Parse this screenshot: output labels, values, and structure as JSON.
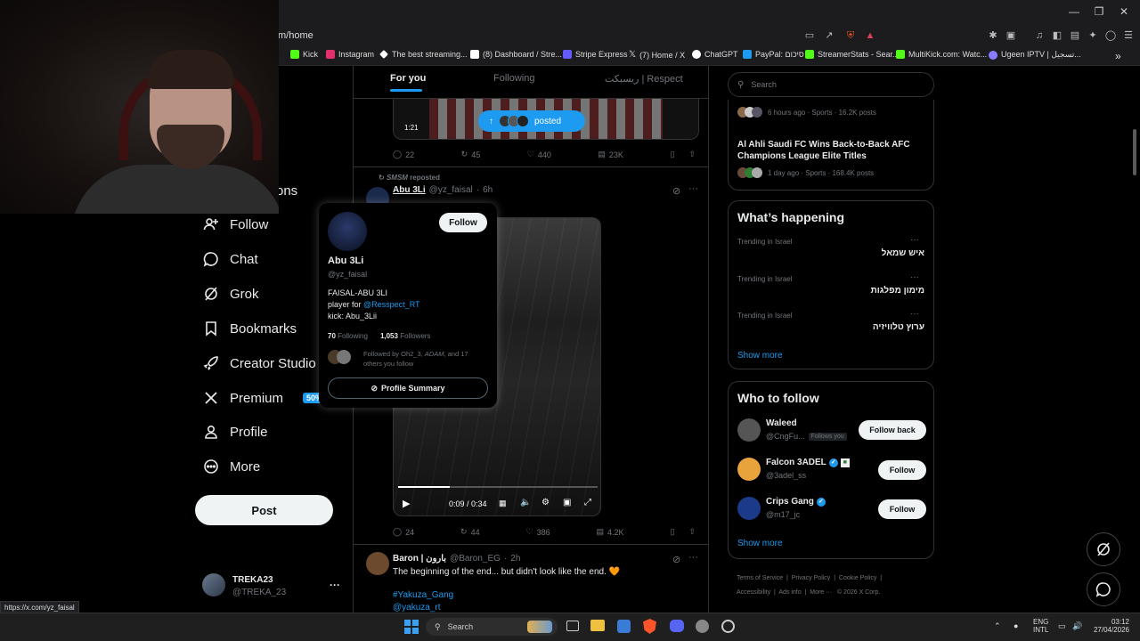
{
  "browser": {
    "url": "m/home",
    "status_url": "https://x.com/yz_faisal",
    "bookmarks": [
      {
        "label": "Kick",
        "color": "#53fc18"
      },
      {
        "label": "Instagram",
        "color": "#e1306c"
      },
      {
        "label": "The best streaming...",
        "color": "#ffffff"
      },
      {
        "label": "(8) Dashboard / Stre...",
        "color": "#ffffff"
      },
      {
        "label": "Stripe Express",
        "color": "#635bff"
      },
      {
        "label": "(7) Home / X",
        "color": "#ffffff"
      },
      {
        "label": "ChatGPT",
        "color": "#ffffff"
      },
      {
        "label": "PayPal: סיכום",
        "color": "#1d9bf0"
      },
      {
        "label": "StreamerStats - Sear...",
        "color": "#53fc18"
      },
      {
        "label": "MultiKick.com: Watc...",
        "color": "#53fc18"
      },
      {
        "label": "Ugeen IPTV | تسجيل...",
        "color": "#8a7cff"
      }
    ]
  },
  "nav": {
    "partial_label": "ons",
    "items": [
      {
        "label": "Follow",
        "icon": "person-plus-icon"
      },
      {
        "label": "Chat",
        "icon": "chat-bubble-icon"
      },
      {
        "label": "Grok",
        "icon": "grok-icon"
      },
      {
        "label": "Bookmarks",
        "icon": "bookmark-icon"
      },
      {
        "label": "Creator Studio",
        "icon": "rocket-icon"
      },
      {
        "label": "Premium",
        "icon": "x-logo-icon",
        "badge": "50% off"
      },
      {
        "label": "Profile",
        "icon": "person-icon"
      },
      {
        "label": "More",
        "icon": "more-circle-icon"
      }
    ],
    "post_label": "Post",
    "account": {
      "name": "TREKA23",
      "handle": "@TREKA_23",
      "more": "···"
    }
  },
  "feed": {
    "tabs": [
      {
        "label": "For you",
        "active": true
      },
      {
        "label": "Following",
        "active": false
      },
      {
        "label": "ريسبكت | Respect",
        "active": false
      }
    ],
    "top_video": {
      "duration": "1:21",
      "posted_label": "posted"
    },
    "top_actions": {
      "replies": "22",
      "reposts": "45",
      "likes": "440",
      "views": "23K"
    },
    "repost": {
      "reposter": "SMSM",
      "reposted_label": "reposted",
      "author": "Abu 3Li",
      "handle": "@yz_faisal",
      "time": "6h",
      "video_time": "0:09 / 0:34",
      "video_progress": 0.26,
      "actions": {
        "replies": "24",
        "reposts": "44",
        "likes": "386",
        "views": "4.2K"
      }
    },
    "next_post": {
      "author": "Baron | بارون",
      "handle": "@Baron_EG",
      "time": "2h",
      "text": "The beginning of the end... but didn't look like the end. 🧡",
      "hashtag": "#Yakuza_Gang",
      "mention": "@yakuza_rt"
    }
  },
  "hovercard": {
    "follow_label": "Follow",
    "name": "Abu 3Li",
    "handle": "@yz_faisal",
    "bio_line1": "FAISAL-ABU 3LI",
    "bio_line2_prefix": "player for ",
    "bio_line2_link": "@Resspect_RT",
    "bio_line3": "kick: Abu_3Lii",
    "following_count": "70",
    "following_label": "Following",
    "followers_count": "1,053",
    "followers_label": "Followers",
    "followed_by_prefix": "Followed by ",
    "followed_by_names": "Oh2_3, ",
    "followed_by_adam": "ADAM",
    "followed_by_suffix": ", and 17",
    "followed_by_line2": "others you follow",
    "summary_label": "Profile Summary"
  },
  "right": {
    "search_placeholder": "Search",
    "news": [
      {
        "meta": "6 hours ago · Sports · 16.2K posts"
      },
      {
        "title": "Al Ahli Saudi FC Wins Back-to-Back AFC Champions League Elite Titles",
        "meta": "1 day ago · Sports · 168.4K posts"
      }
    ],
    "happening": {
      "title": "What’s happening",
      "trends": [
        {
          "context": "Trending in Israel",
          "topic": "איש שמאל"
        },
        {
          "context": "Trending in Israel",
          "topic": "מימון מפלגות"
        },
        {
          "context": "Trending in Israel",
          "topic": "ערוץ טלוויזיה"
        }
      ],
      "show_more": "Show more"
    },
    "who_to_follow": {
      "title": "Who to follow",
      "users": [
        {
          "name": "Waleed",
          "handle": "@CngFu...",
          "tag": "Follows you",
          "button": "Follow back",
          "avatar_color": "#555555"
        },
        {
          "name": "Falcon 3ADEL",
          "handle": "@3adel_ss",
          "tag": "",
          "button": "Follow",
          "avatar_color": "#e8a33d",
          "verified": true
        },
        {
          "name": "Crips Gang",
          "handle": "@m17_jc",
          "tag": "",
          "button": "Follow",
          "avatar_color": "#1b3a8a",
          "verified": true
        }
      ],
      "show_more": "Show more"
    },
    "footer": [
      "Terms of Service",
      "Privacy Policy",
      "Cookie Policy",
      "Accessibility",
      "Ads info",
      "More ···",
      "© 2026 X Corp."
    ]
  },
  "taskbar": {
    "search_label": "Search",
    "lang_top": "ENG",
    "lang_bottom": "INTL",
    "time": "03:12",
    "date": "27/04/2026"
  },
  "colors": {
    "accent": "#1d9bf0",
    "bg": "#000000",
    "border": "#2f3336",
    "muted": "#71767b"
  }
}
